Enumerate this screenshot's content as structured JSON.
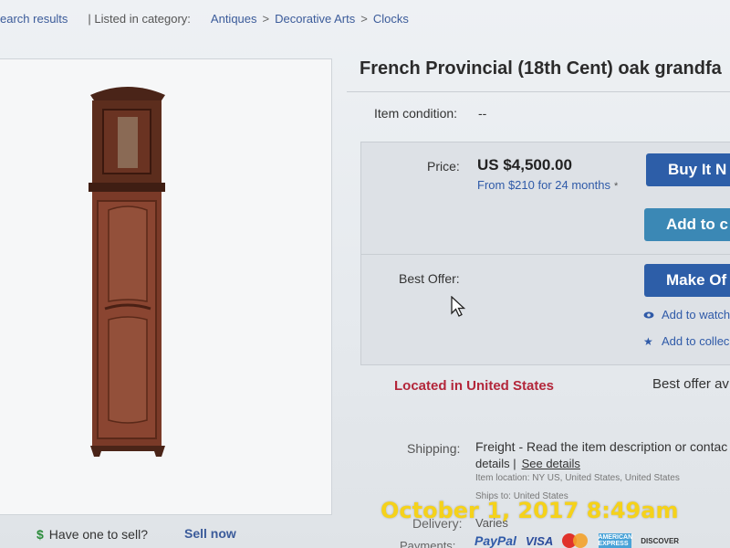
{
  "breadcrumb": {
    "back_text": "earch results",
    "category_label": "| Listed in category:",
    "items": [
      "Antiques",
      "Decorative Arts",
      "Clocks"
    ],
    "separator": ">"
  },
  "listing": {
    "title": "French Provincial (18th Cent) oak grandfa",
    "condition_label": "Item condition:",
    "condition_value": "--"
  },
  "buybox": {
    "price_label": "Price:",
    "price_value": "US $4,500.00",
    "finance_text": "From $210 for 24 months",
    "finance_mark": "*",
    "buy_button": "Buy It N",
    "cart_button": "Add to c",
    "best_offer_label": "Best Offer:",
    "offer_button": "Make Of",
    "watch_link": "Add to watch",
    "collection_link": "Add to collec"
  },
  "location": {
    "located_text": "Located in United States",
    "best_offer_text": "Best offer av"
  },
  "shipping": {
    "label": "Shipping:",
    "main": "Freight - Read the item description or contac",
    "details_text": "details |",
    "see_details": "See details",
    "item_location": "Item location:  NY US, United States, United States",
    "ships_to": "Ships to:  United States",
    "delivery_label": "Delivery:",
    "delivery_value": "Varies",
    "payments_label": "Payments:",
    "payment_methods": [
      "PayPal",
      "VISA",
      "AMERICAN EXPRESS",
      "DISCOVER"
    ]
  },
  "sell": {
    "have_one": "Have one to sell?",
    "sell_now": "Sell now",
    "dollar_icon": "$"
  },
  "timestamp": "October 1, 2017 8:49am",
  "colors": {
    "primary_button": "#2d5ea8",
    "cart_button": "#3b88b5",
    "located_red": "#b3263a",
    "stamp_yellow": "#f5d21a",
    "link_blue": "#2f5aa8"
  },
  "icons": [
    "eye-icon",
    "star-icon",
    "dollar-icon",
    "mouse-cursor-icon"
  ]
}
